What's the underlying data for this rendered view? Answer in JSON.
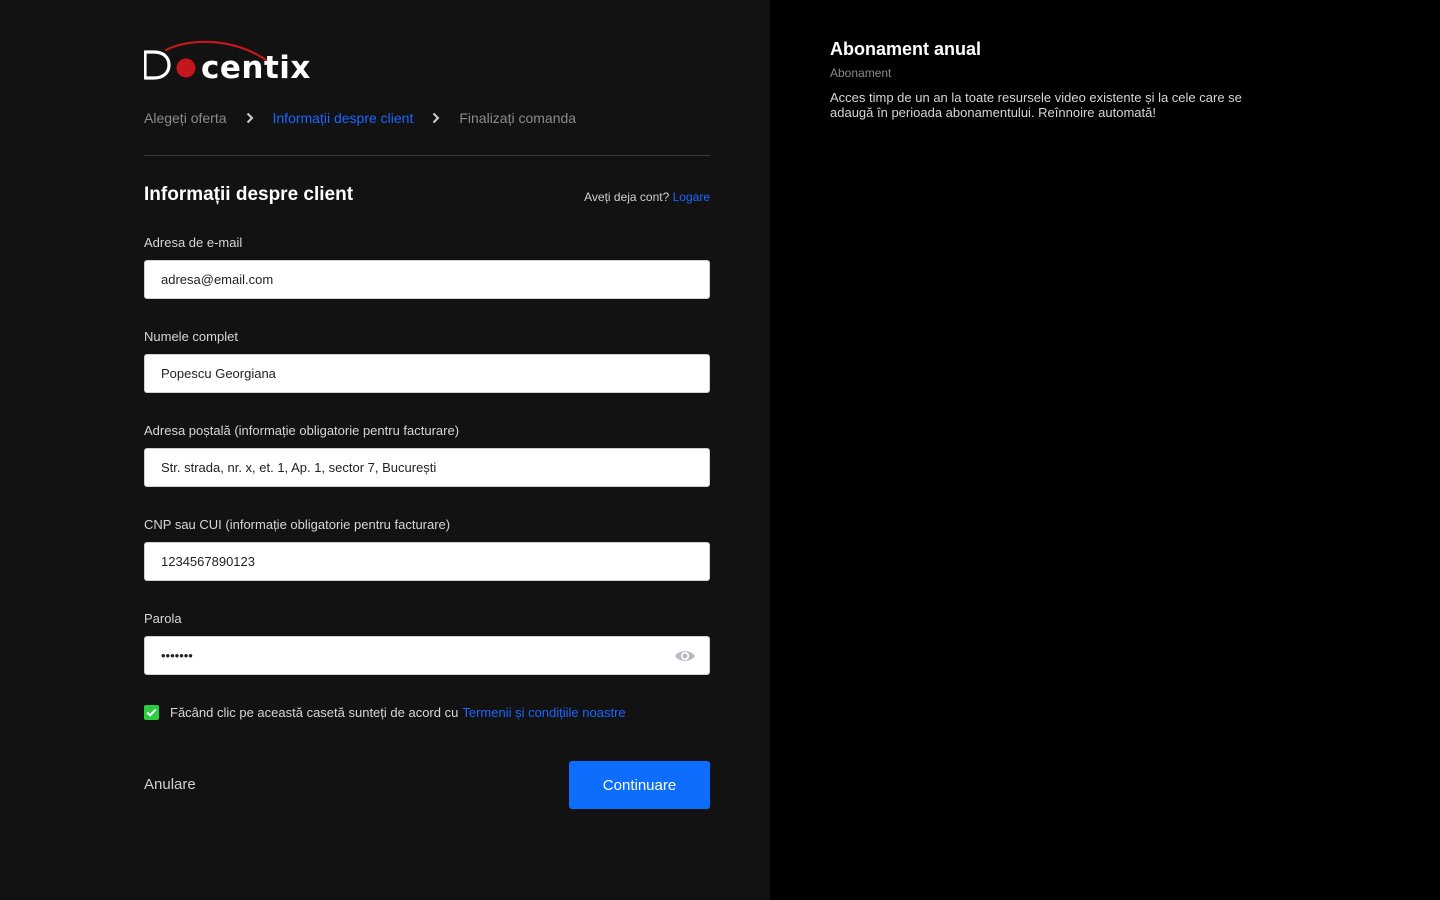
{
  "brand": {
    "logo_text": "Docentix",
    "accent_color": "#c4161c"
  },
  "steps": [
    {
      "label": "Alegeți oferta",
      "state": "done"
    },
    {
      "label": "Informații despre client",
      "state": "active"
    },
    {
      "label": "Finalizați comanda",
      "state": "pending"
    }
  ],
  "form": {
    "title": "Informații despre client",
    "account_prompt": "Aveți deja cont?",
    "login_link": "Logare",
    "fields": {
      "email": {
        "label": "Adresa de e-mail",
        "value": "adresa@email.com"
      },
      "name": {
        "label": "Numele complet",
        "value": "Popescu Georgiana"
      },
      "address": {
        "label": "Adresa poștală (informație obligatorie pentru facturare)",
        "value": "Str. strada, nr. x, et. 1, Ap. 1, sector 7, București"
      },
      "cnp": {
        "label": "CNP sau CUI (informație obligatorie pentru facturare)",
        "value": "1234567890123"
      },
      "password": {
        "label": "Parola",
        "value": "1234567",
        "reveal_icon": "eye-icon"
      }
    },
    "terms": {
      "checked": true,
      "text": "Făcând clic pe această casetă sunteți de acord cu",
      "link": "Termenii și condițiile noastre"
    },
    "cancel_label": "Anulare",
    "continue_label": "Continuare"
  },
  "plan": {
    "title": "Abonament anual",
    "type": "Abonament",
    "description": "Acces timp de un an la toate resursele video existente și la cele care se adaugă în perioada abonamentului. Reînnoire automată!"
  },
  "colors": {
    "link": "#1a66ff",
    "primary_button": "#0d6efd",
    "checkbox": "#2ecc40",
    "left_panel": "#121212",
    "right_panel": "#000000"
  }
}
